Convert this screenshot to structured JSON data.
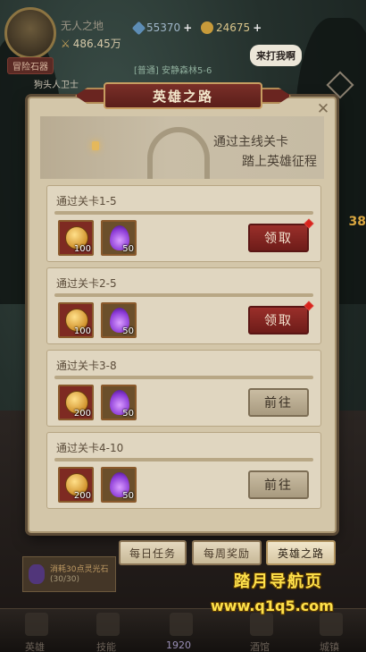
{
  "hud": {
    "player_name": "无人之地",
    "power": "486.45万",
    "gems": "55370",
    "gold": "24675",
    "plus": "+",
    "adventure_badge": "冒险石器",
    "guard_label": "狗头人卫士",
    "stage_tag": "[普通] 安静森林5-6",
    "speech": "来打我啊",
    "side_number": "38"
  },
  "modal": {
    "title": "英雄之路",
    "close_icon": "close-icon",
    "banner_line1": "通过主线关卡",
    "banner_line2": "踏上英雄征程"
  },
  "quests": [
    {
      "title": "通过关卡1-5",
      "coin_qty": "100",
      "soul_qty": "50",
      "button": "领取",
      "state": "claim",
      "badge": true
    },
    {
      "title": "通过关卡2-5",
      "coin_qty": "100",
      "soul_qty": "50",
      "button": "领取",
      "state": "claim",
      "badge": true
    },
    {
      "title": "通过关卡3-8",
      "coin_qty": "200",
      "soul_qty": "50",
      "button": "前往",
      "state": "go",
      "badge": false
    },
    {
      "title": "通过关卡4-10",
      "coin_qty": "200",
      "soul_qty": "50",
      "button": "前往",
      "state": "go",
      "badge": false
    }
  ],
  "tabs": {
    "daily": "每日任务",
    "weekly": "每周奖励",
    "hero_road": "英雄之路",
    "active": "hero_road"
  },
  "task_strip": {
    "text": "消耗30点灵光石",
    "progress": "(30/30)"
  },
  "bottom_nav": {
    "items": [
      "英雄",
      "技能",
      "",
      "酒馆",
      "城镇"
    ],
    "center_count": "1920"
  },
  "watermark": {
    "line1": "踏月导航页",
    "line2": "www.q1q5.com"
  },
  "colors": {
    "claim_button": "#8a2a25",
    "go_button": "#b9ab90",
    "panel": "#d3c6a9",
    "banner": "#6e2621",
    "watermark": "#ffe14a"
  }
}
